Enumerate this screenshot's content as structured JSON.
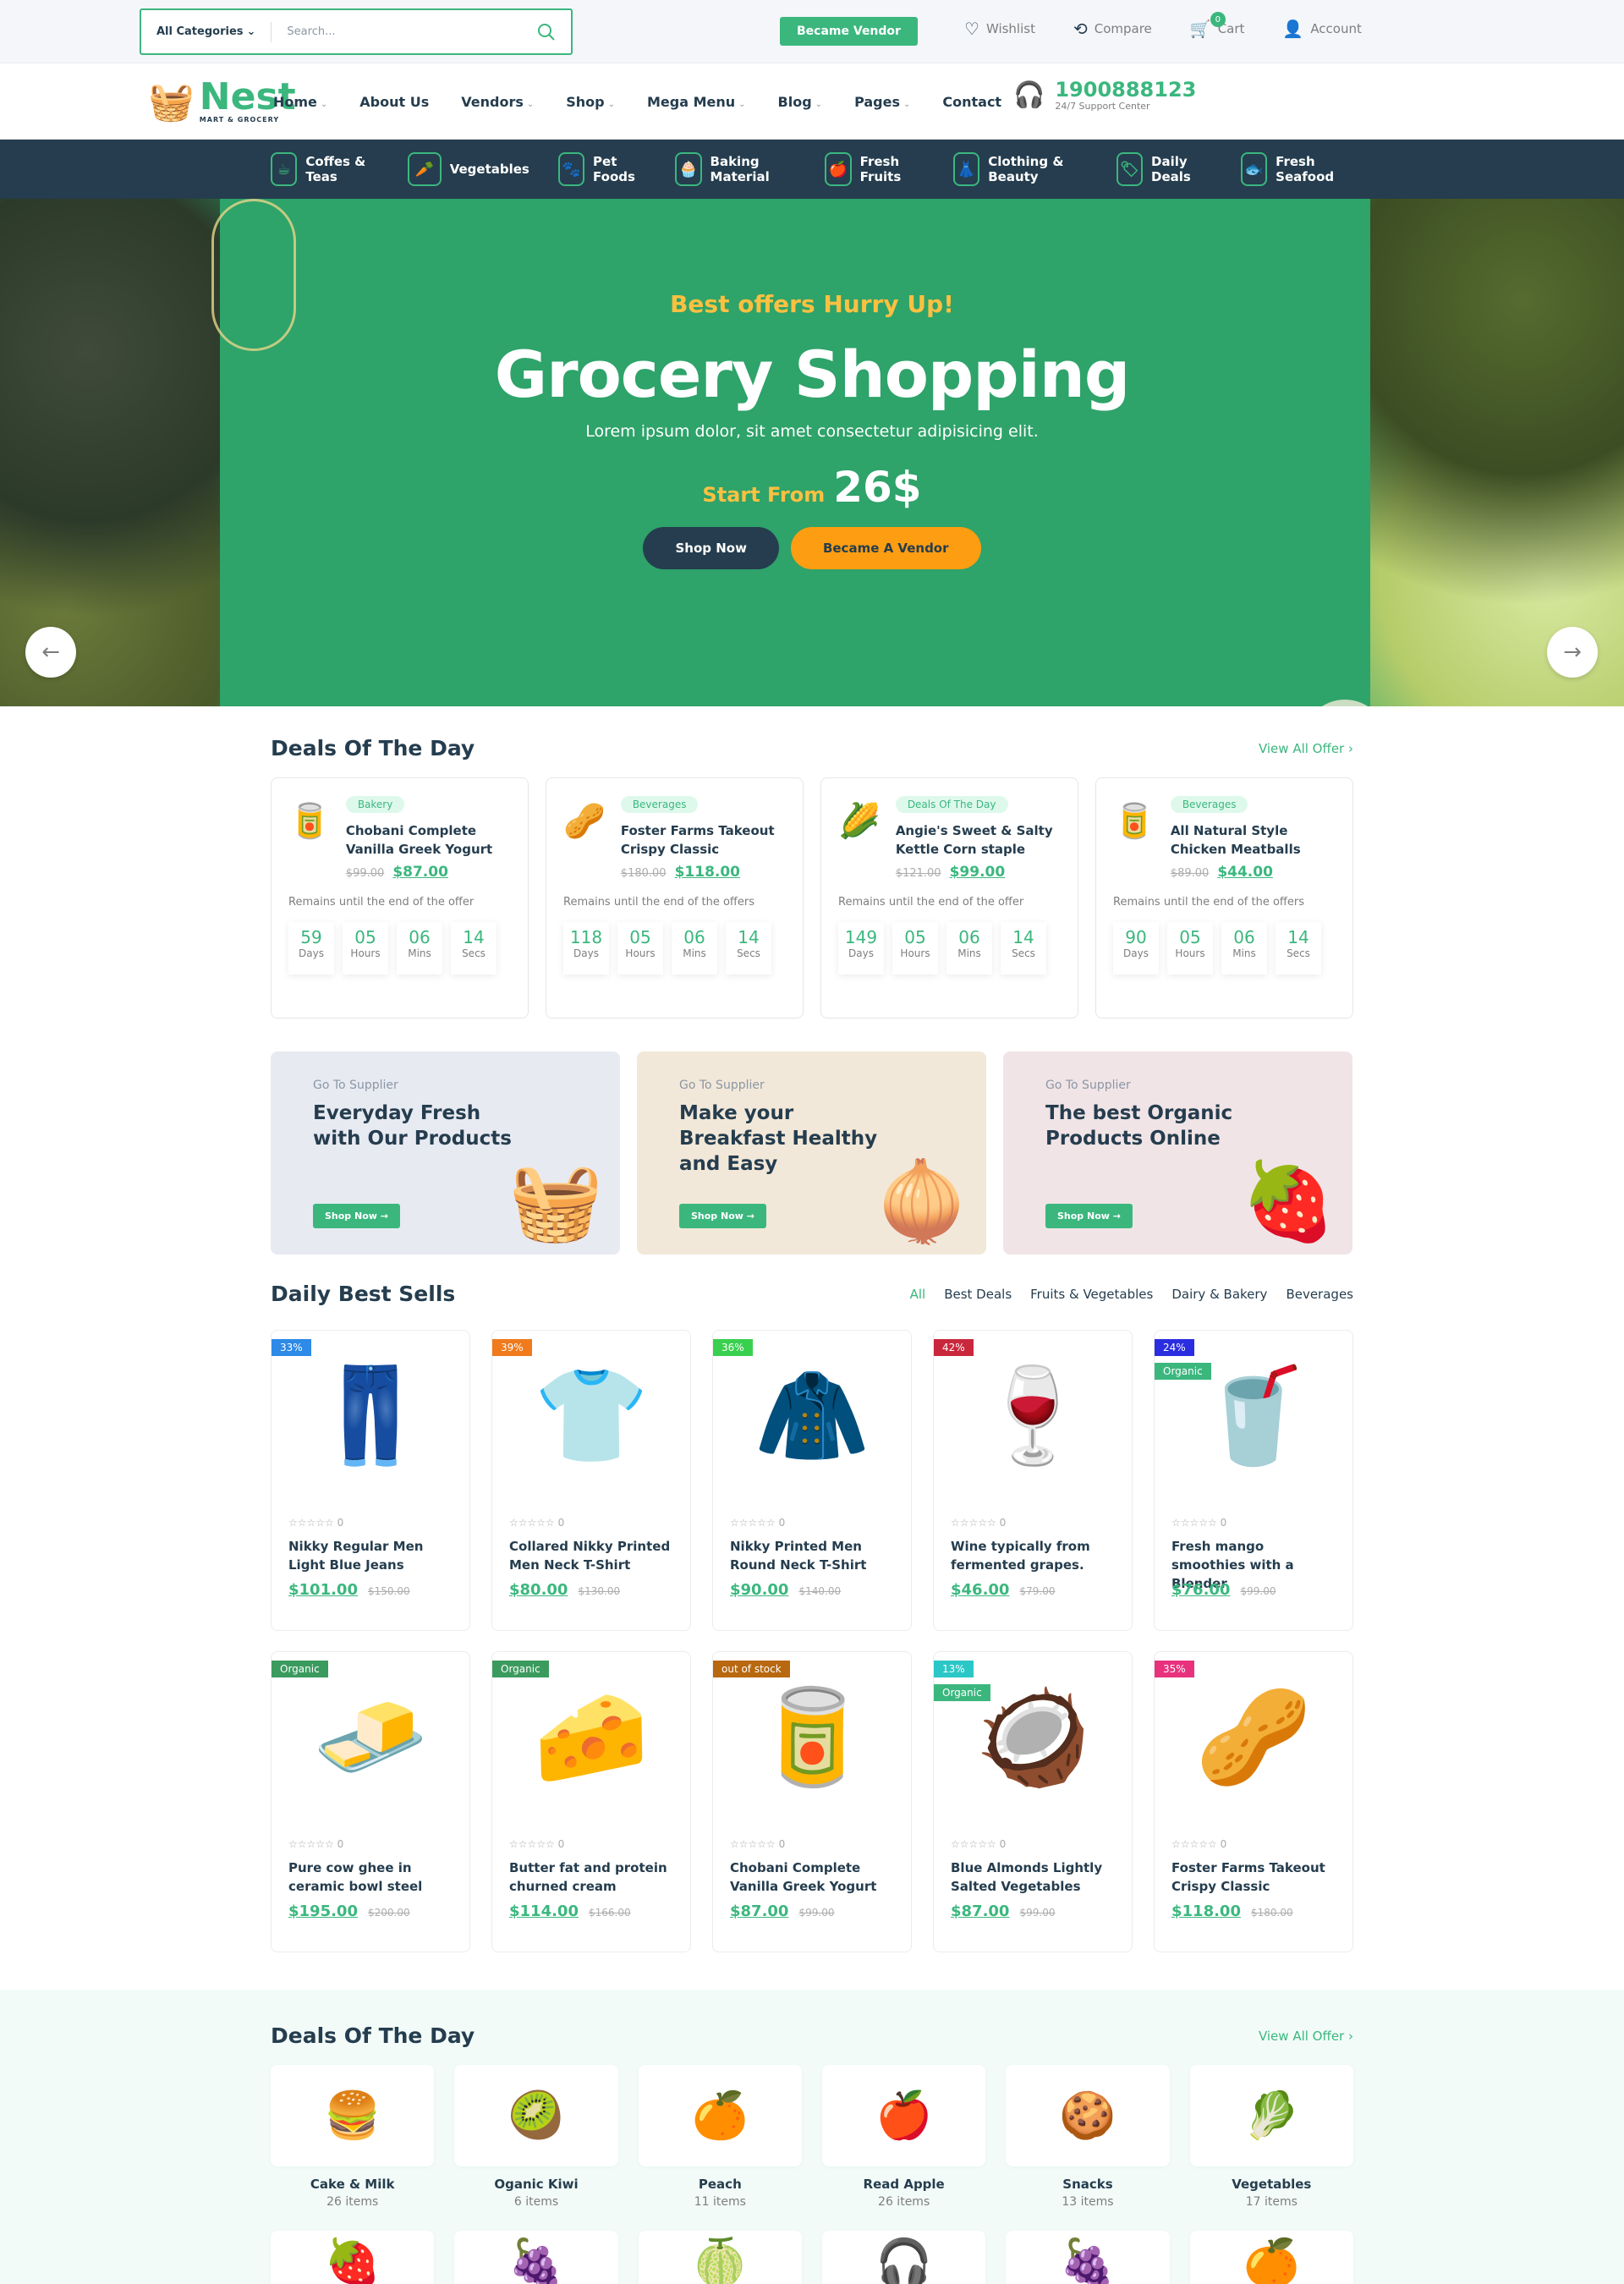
{
  "topbar": {
    "category_select": "All Categories",
    "search_placeholder": "Search...",
    "vendor_button": "Became Vendor",
    "actions": [
      {
        "label": "Wishlist",
        "icon": "heart-icon"
      },
      {
        "label": "Compare",
        "icon": "compare-icon"
      },
      {
        "label": "Cart",
        "icon": "cart-icon",
        "count": "0"
      },
      {
        "label": "Account",
        "icon": "user-icon"
      }
    ]
  },
  "header": {
    "logo_name": "Nest",
    "logo_sub": "MART & GROCERY",
    "nav": [
      "Home",
      "About Us",
      "Vendors",
      "Shop",
      "Mega Menu",
      "Blog",
      "Pages",
      "Contact"
    ],
    "nav_dropdown": [
      true,
      false,
      true,
      true,
      true,
      true,
      true,
      false
    ],
    "support_number": "1900888123",
    "support_label": "24/7 Support Center"
  },
  "category_nav": [
    {
      "label": "Coffes & Teas",
      "icon": "coffee-icon"
    },
    {
      "label": "Vegetables",
      "icon": "vegetables-icon"
    },
    {
      "label": "Pet Foods",
      "icon": "pet-food-icon"
    },
    {
      "label": "Baking Material",
      "icon": "baking-icon"
    },
    {
      "label": "Fresh Fruits",
      "icon": "fruits-icon"
    },
    {
      "label": "Clothing & Beauty",
      "icon": "clothing-icon"
    },
    {
      "label": "Daily Deals",
      "icon": "deals-icon"
    },
    {
      "label": "Fresh Seafood",
      "icon": "seafood-icon"
    }
  ],
  "hero": {
    "tagline": "Best offers Hurry Up!",
    "title": "Grocery Shopping",
    "description": "Lorem ipsum dolor, sit amet consectetur adipisicing elit.",
    "price_label": "Start From",
    "price_value": "26$",
    "primary_button": "Shop Now",
    "secondary_button": "Became A Vendor"
  },
  "deals": {
    "title": "Deals Of The Day",
    "view_all": "View All Offer",
    "units": [
      "Days",
      "Hours",
      "Mins",
      "Secs"
    ],
    "items": [
      {
        "badge": "Bakery",
        "name": "Chobani Complete Vanilla Greek Yogurt",
        "old_price": "$99.00",
        "price": "$87.00",
        "remain": "Remains until the end of the offer",
        "countdown": [
          "59",
          "05",
          "06",
          "14"
        ],
        "emoji": "🥫"
      },
      {
        "badge": "Beverages",
        "name": "Foster Farms Takeout Crispy Classic",
        "old_price": "$180.00",
        "price": "$118.00",
        "remain": "Remains until the end of the offers",
        "countdown": [
          "118",
          "05",
          "06",
          "14"
        ],
        "emoji": "🥜"
      },
      {
        "badge": "Deals Of The Day",
        "name": "Angie's Sweet & Salty Kettle Corn staple",
        "old_price": "$121.00",
        "price": "$99.00",
        "remain": "Remains until the end of the offer",
        "countdown": [
          "149",
          "05",
          "06",
          "14"
        ],
        "emoji": "🌽"
      },
      {
        "badge": "Beverages",
        "name": "All Natural Style Chicken Meatballs",
        "old_price": "$89.00",
        "price": "$44.00",
        "remain": "Remains until the end of the offers",
        "countdown": [
          "90",
          "05",
          "06",
          "14"
        ],
        "emoji": "🥫"
      }
    ]
  },
  "banners": [
    {
      "sub": "Go To Supplier",
      "title": "Everyday Fresh with Our Products",
      "button": "Shop Now →",
      "bg": "#e8eaf2",
      "emoji": "🧺"
    },
    {
      "sub": "Go To Supplier",
      "title": "Make your Breakfast Healthy and Easy",
      "button": "Shop Now →",
      "bg": "#f2e8d9",
      "emoji": "🧅"
    },
    {
      "sub": "Go To Supplier",
      "title": "The best Organic Products Online",
      "button": "Shop Now →",
      "bg": "#f1e4e6",
      "emoji": "🍓"
    }
  ],
  "best_sells": {
    "title": "Daily Best Sells",
    "filters": [
      "All",
      "Best Deals",
      "Fruits & Vegetables",
      "Dairy & Bakery",
      "Beverages"
    ],
    "rating_count": "0",
    "products": [
      {
        "tag": "33%",
        "tag_color": "#2d8ae6",
        "name": "Nikky Regular Men Light Blue Jeans",
        "price": "$101.00",
        "old_price": "$150.00",
        "emoji": "👖"
      },
      {
        "tag": "39%",
        "tag_color": "#f07a1c",
        "name": "Collared Nikky Printed Men Neck T-Shirt",
        "price": "$80.00",
        "old_price": "$130.00",
        "emoji": "👕"
      },
      {
        "tag": "36%",
        "tag_color": "#3ad04f",
        "name": "Nikky Printed Men Round Neck T-Shirt",
        "price": "$90.00",
        "old_price": "$140.00",
        "emoji": "🧥"
      },
      {
        "tag": "42%",
        "tag_color": "#c9283c",
        "name": "Wine typically from fermented grapes.",
        "price": "$46.00",
        "old_price": "$79.00",
        "emoji": "🍷"
      },
      {
        "tag": "24%",
        "tag_color": "#2a2ee0",
        "tag2": "Organic",
        "name": "Fresh mango smoothies with a Blender",
        "price": "$76.00",
        "old_price": "$99.00",
        "emoji": "🥤"
      },
      {
        "tag": "Organic",
        "tag_color": "#3b9b5e",
        "name": "Pure cow ghee in ceramic bowl steel",
        "price": "$195.00",
        "old_price": "$200.00",
        "emoji": "🧈"
      },
      {
        "tag": "Organic",
        "tag_color": "#3b9b5e",
        "name": "Butter fat and protein churned cream",
        "price": "$114.00",
        "old_price": "$166.00",
        "emoji": "🧀"
      },
      {
        "tag": "out of stock",
        "tag_color": "#b8680f",
        "name": "Chobani Complete Vanilla Greek Yogurt",
        "price": "$87.00",
        "old_price": "$99.00",
        "emoji": "🥫"
      },
      {
        "tag": "13%",
        "tag_color": "#2bc7c7",
        "tag2": "Organic",
        "name": "Blue Almonds Lightly Salted Vegetables",
        "price": "$87.00",
        "old_price": "$99.00",
        "emoji": "🥥"
      },
      {
        "tag": "35%",
        "tag_color": "#e8327e",
        "name": "Foster Farms Takeout Crispy Classic",
        "price": "$118.00",
        "old_price": "$180.00",
        "emoji": "🥜"
      }
    ]
  },
  "categories": {
    "title": "Deals Of The Day",
    "view_all": "View All Offer",
    "items": [
      {
        "name": "Cake & Milk",
        "count": "26 items",
        "emoji": "🍔"
      },
      {
        "name": "Oganic Kiwi",
        "count": "6 items",
        "emoji": "🥝"
      },
      {
        "name": "Peach",
        "count": "11 items",
        "emoji": "🍊"
      },
      {
        "name": "Read Apple",
        "count": "26 items",
        "emoji": "🍎"
      },
      {
        "name": "Snacks",
        "count": "13 items",
        "emoji": "🍪"
      },
      {
        "name": "Vegetables",
        "count": "17 items",
        "emoji": "🥬"
      }
    ],
    "row2": [
      "🍓",
      "🍇",
      "🍈",
      "🎧",
      "🍇",
      "🍊"
    ]
  }
}
